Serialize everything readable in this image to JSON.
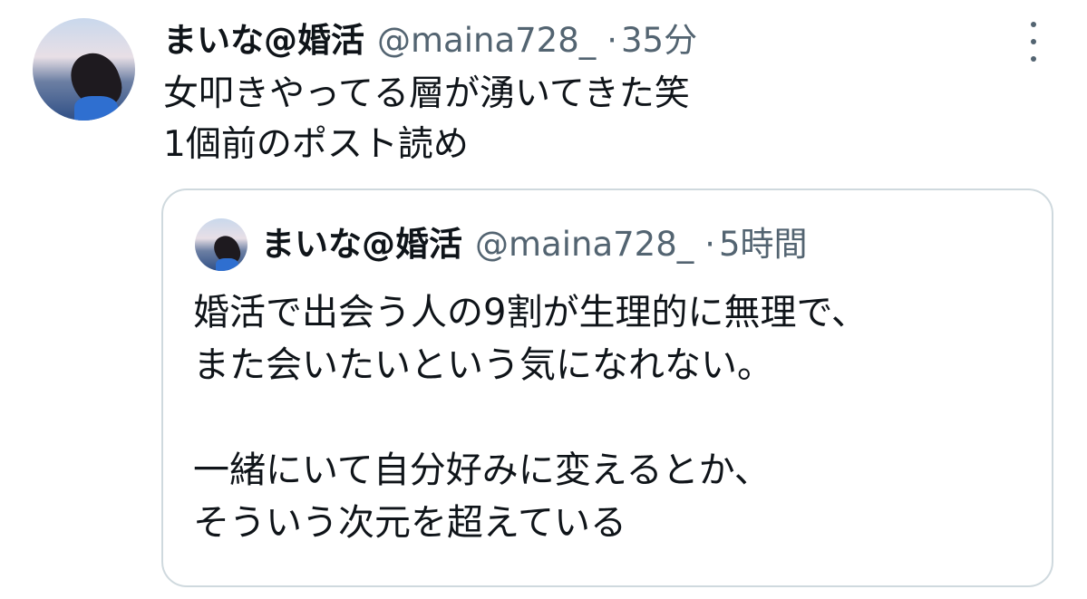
{
  "tweet": {
    "author": {
      "display_name": "まいな@婚活",
      "handle": "@maina728_",
      "avatar": "profile-photo"
    },
    "separator": "·",
    "time": "35分",
    "more_icon": "more-vertical-icon",
    "text_lines": [
      "女叩きやってる層が湧いてきた笑",
      "1個前のポスト読め"
    ]
  },
  "quote": {
    "author": {
      "display_name": "まいな@婚活",
      "handle": "@maina728_",
      "avatar": "profile-photo"
    },
    "separator": "·",
    "time": "5時間",
    "text_lines": [
      "婚活で出会う人の9割が生理的に無理で、",
      "また会いたいという気になれない。",
      "",
      "一緒にいて自分好みに変えるとか、",
      "そういう次元を超えている"
    ]
  },
  "colors": {
    "text_primary": "#0f1419",
    "text_secondary": "#536471",
    "border": "#cfd9de",
    "background": "#ffffff"
  }
}
